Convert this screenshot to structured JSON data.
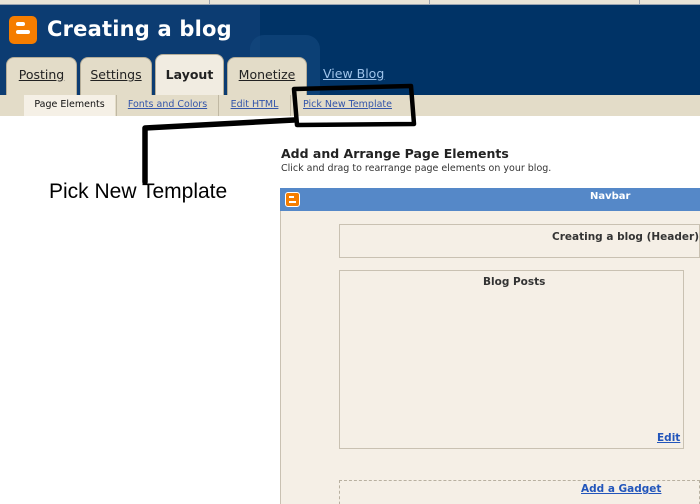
{
  "header": {
    "blog_title": "Creating a blog",
    "logo_icon": "blogger-logo-icon",
    "colors": {
      "header_bg": "#003366",
      "logo": "#f57d00",
      "tab_bg": "#e3dcc8"
    }
  },
  "tabs": [
    {
      "label": "Posting",
      "active": false
    },
    {
      "label": "Settings",
      "active": false
    },
    {
      "label": "Layout",
      "active": true
    },
    {
      "label": "Monetize",
      "active": false
    }
  ],
  "view_blog_label": "View Blog",
  "subtabs": [
    {
      "label": "Page Elements",
      "active": true
    },
    {
      "label": "Fonts and Colors",
      "active": false
    },
    {
      "label": "Edit HTML",
      "active": false
    },
    {
      "label": "Pick New Template",
      "active": false
    }
  ],
  "annotation": {
    "text": "Pick New Template"
  },
  "main": {
    "title": "Add and Arrange Page Elements",
    "subtitle": "Click and drag to rearrange page elements on your blog.",
    "navbar_label": "Navbar",
    "header_box_label": "Creating a blog (Header)",
    "posts_box_label": "Blog Posts",
    "edit_label": "Edit",
    "add_gadget_label": "Add a Gadget"
  }
}
